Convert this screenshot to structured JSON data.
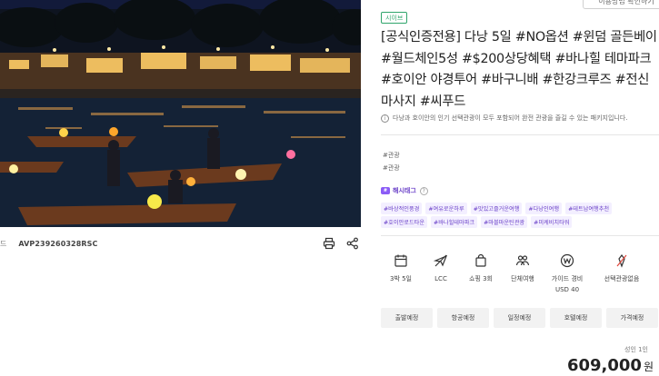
{
  "product": {
    "code_label": "드",
    "code_value": "AVP239260328RSC"
  },
  "actions": {
    "print_icon": "print-icon",
    "share_icon": "share-icon"
  },
  "right": {
    "top_button_label": "이용방법 확인하기",
    "badge": "시이브",
    "title": "[공식인증전용] 다낭 5일 #NO옵션 #윈덤 골든베이 #월드체인5성 #$200상당혜택 #바나힐 테마파크 #호이안 야경투어 #바구니배 #한강크루즈 #전신마사지 #씨푸드",
    "notice": "다낭과 호이안의 인기 선택관광이 모두 포함되어 완전 관광을 즐길 수 있는 패키지입니다.",
    "tags": [
      "#관광",
      "#관광"
    ],
    "hashtag_title": "해시태그",
    "chips_row1": [
      "#바상적인풍경",
      "#여유로운하루",
      "#맛있고즐거운여행",
      "#다낭인여행",
      "#테트남여행추천"
    ],
    "chips_row2": [
      "#호이안로드타운",
      "#바나힐테마파크",
      "#마블마운틴관광",
      "#미케비치타워"
    ],
    "features": [
      {
        "icon": "calendar-icon",
        "label": "3박 5일"
      },
      {
        "icon": "plane-icon",
        "label": "LCC"
      },
      {
        "icon": "shopping-bag-icon",
        "label": "쇼핑 3회"
      },
      {
        "icon": "group-icon",
        "label": "단체여행"
      },
      {
        "icon": "won-coin-icon",
        "label": "가이드 경비",
        "sub": "USD 40"
      },
      {
        "icon": "no-option-icon",
        "label": "선택관광없음"
      }
    ],
    "tabs": [
      "출발예정",
      "항공예정",
      "일정예정",
      "호텔예정",
      "가격예정"
    ],
    "price_label": "성인 1인",
    "price": "609,000",
    "currency": "원"
  },
  "colors": {
    "accent_green": "#2fa56b",
    "hashtag_purple": "#6a40c8"
  }
}
